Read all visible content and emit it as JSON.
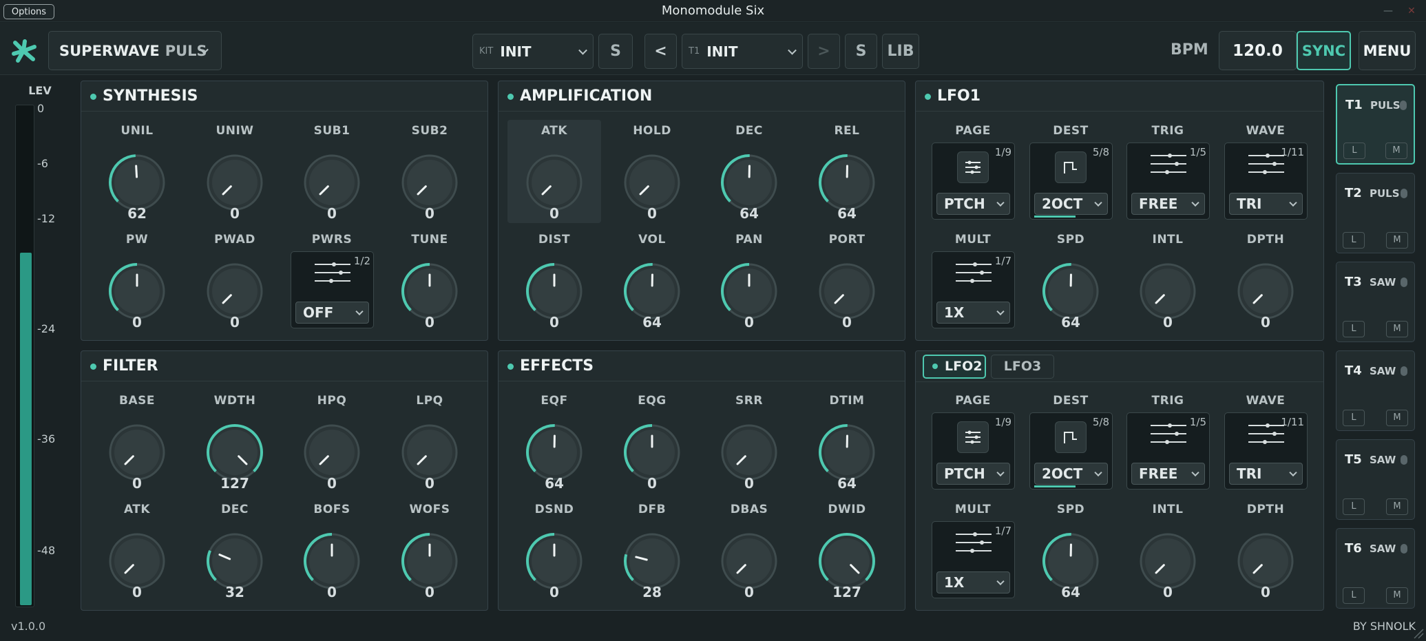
{
  "window": {
    "title": "Monomodule Six",
    "options_label": "Options",
    "minimize": "—",
    "close": "✕"
  },
  "topbar": {
    "preset_name": "SUPERWAVE",
    "preset_suffix": "PULS",
    "kit_label": "KIT",
    "kit_value": "INIT",
    "kit_save": "S",
    "prev": "<",
    "track_label": "T1",
    "track_value": "INIT",
    "next": ">",
    "track_save": "S",
    "lib": "LIB",
    "bpm_label": "BPM",
    "bpm_value": "120.0",
    "sync": "SYNC",
    "menu": "MENU"
  },
  "level": {
    "label": "LEV",
    "ticks": [
      "0",
      "-6",
      "-12",
      "-24",
      "-36",
      "-48"
    ],
    "fill_fraction": 0.7
  },
  "colors": {
    "accent": "#4ec9b0",
    "background": "#1a2224",
    "panel": "#222c2e"
  },
  "panels": {
    "synthesis": {
      "title": "SYNTHESIS",
      "knobs": [
        {
          "label": "UNIL",
          "value": "62"
        },
        {
          "label": "UNIW",
          "value": "0"
        },
        {
          "label": "SUB1",
          "value": "0"
        },
        {
          "label": "SUB2",
          "value": "0"
        },
        {
          "label": "PW",
          "value": "0"
        },
        {
          "label": "PWAD",
          "value": "0"
        },
        {
          "label": "PWRS",
          "selector": true,
          "count": "1/2",
          "option": "OFF"
        },
        {
          "label": "TUNE",
          "value": "0"
        }
      ]
    },
    "amplification": {
      "title": "AMPLIFICATION",
      "knobs": [
        {
          "label": "ATK",
          "value": "0"
        },
        {
          "label": "HOLD",
          "value": "0"
        },
        {
          "label": "DEC",
          "value": "64"
        },
        {
          "label": "REL",
          "value": "64"
        },
        {
          "label": "DIST",
          "value": "0"
        },
        {
          "label": "VOL",
          "value": "64"
        },
        {
          "label": "PAN",
          "value": "0"
        },
        {
          "label": "PORT",
          "value": "0"
        }
      ]
    },
    "lfo1": {
      "title": "LFO1",
      "knobs": [
        {
          "label": "PAGE",
          "selector": true,
          "count": "1/9",
          "option": "PTCH",
          "icon": "sliders-icon"
        },
        {
          "label": "DEST",
          "selector": true,
          "count": "5/8",
          "option": "2OCT",
          "icon": "step-icon"
        },
        {
          "label": "TRIG",
          "selector": true,
          "count": "1/5",
          "option": "FREE"
        },
        {
          "label": "WAVE",
          "selector": true,
          "count": "1/11",
          "option": "TRI"
        },
        {
          "label": "MULT",
          "selector": true,
          "count": "1/7",
          "option": "1X"
        },
        {
          "label": "SPD",
          "value": "64"
        },
        {
          "label": "INTL",
          "value": "0"
        },
        {
          "label": "DPTH",
          "value": "0"
        }
      ]
    },
    "filter": {
      "title": "FILTER",
      "knobs": [
        {
          "label": "BASE",
          "value": "0"
        },
        {
          "label": "WDTH",
          "value": "127"
        },
        {
          "label": "HPQ",
          "value": "0"
        },
        {
          "label": "LPQ",
          "value": "0"
        },
        {
          "label": "ATK",
          "value": "0"
        },
        {
          "label": "DEC",
          "value": "32"
        },
        {
          "label": "BOFS",
          "value": "0"
        },
        {
          "label": "WOFS",
          "value": "0"
        }
      ]
    },
    "effects": {
      "title": "EFFECTS",
      "knobs": [
        {
          "label": "EQF",
          "value": "64"
        },
        {
          "label": "EQG",
          "value": "0"
        },
        {
          "label": "SRR",
          "value": "0"
        },
        {
          "label": "DTIM",
          "value": "64"
        },
        {
          "label": "DSND",
          "value": "0"
        },
        {
          "label": "DFB",
          "value": "28"
        },
        {
          "label": "DBAS",
          "value": "0"
        },
        {
          "label": "DWID",
          "value": "127"
        }
      ]
    },
    "lfo23": {
      "tab_active": "LFO2",
      "tab_inactive": "LFO3",
      "knobs": [
        {
          "label": "PAGE",
          "selector": true,
          "count": "1/9",
          "option": "PTCH",
          "icon": "sliders-icon"
        },
        {
          "label": "DEST",
          "selector": true,
          "count": "5/8",
          "option": "2OCT",
          "icon": "step-icon"
        },
        {
          "label": "TRIG",
          "selector": true,
          "count": "1/5",
          "option": "FREE"
        },
        {
          "label": "WAVE",
          "selector": true,
          "count": "1/11",
          "option": "TRI"
        },
        {
          "label": "MULT",
          "selector": true,
          "count": "1/7",
          "option": "1X"
        },
        {
          "label": "SPD",
          "value": "64"
        },
        {
          "label": "INTL",
          "value": "0"
        },
        {
          "label": "DPTH",
          "value": "0"
        }
      ]
    }
  },
  "tracks": [
    {
      "name": "T1",
      "type": "PULS",
      "l": "L",
      "m": "M"
    },
    {
      "name": "T2",
      "type": "PULS",
      "l": "L",
      "m": "M"
    },
    {
      "name": "T3",
      "type": "SAW",
      "l": "L",
      "m": "M"
    },
    {
      "name": "T4",
      "type": "SAW",
      "l": "L",
      "m": "M"
    },
    {
      "name": "T5",
      "type": "SAW",
      "l": "L",
      "m": "M"
    },
    {
      "name": "T6",
      "type": "SAW",
      "l": "L",
      "m": "M"
    }
  ],
  "footer": {
    "version": "v1.0.0",
    "credit": "BY SHNOLK"
  }
}
